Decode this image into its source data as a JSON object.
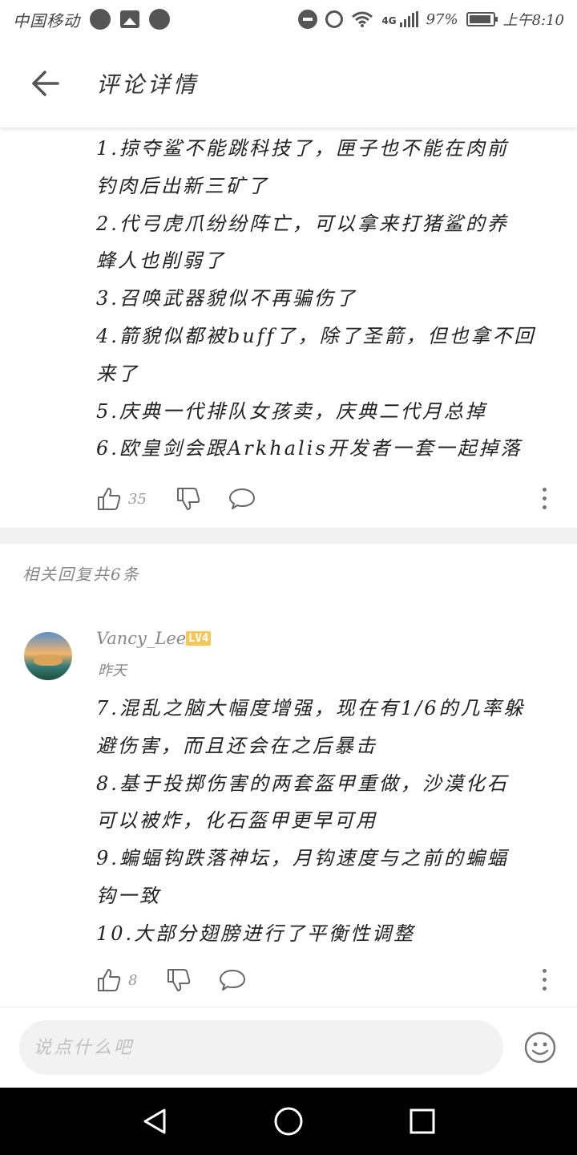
{
  "status_bar": {
    "carrier": "中国移动",
    "network": "4G",
    "battery": "97%",
    "time": "上午8:10"
  },
  "header": {
    "title": "评论详情"
  },
  "main_comment": {
    "lines": [
      "1.掠夺鲨不能跳科技了，匣子也不能在肉前",
      "钓肉后出新三矿了",
      "2.代弓虎爪纷纷阵亡，可以拿来打猪鲨的养",
      "蜂人也削弱了",
      "3.召唤武器貌似不再骗伤了",
      "4.箭貌似都被buff了，除了圣箭，但也拿不回",
      "来了",
      "5.庆典一代排队女孩卖，庆典二代月总掉",
      "6.欧皇剑会跟Arkhalis开发者一套一起掉落"
    ],
    "like_count": "35"
  },
  "related": {
    "header": "相关回复共6条"
  },
  "reply": {
    "username": "Vancy_Lee",
    "level": "LV4",
    "time": "昨天",
    "lines": [
      "7.混乱之脑大幅度增强，现在有1/6的几率躲",
      "避伤害，而且还会在之后暴击",
      "8.基于投掷伤害的两套盔甲重做，沙漠化石",
      "可以被炸，化石盔甲更早可用",
      "9.蝙蝠钩跌落神坛，月钩速度与之前的蝙蝠",
      "钩一致",
      "10.大部分翅膀进行了平衡性调整"
    ],
    "like_count": "8"
  },
  "input": {
    "placeholder": "说点什么吧"
  },
  "colors": {
    "level_badge": "#f5c65a",
    "navbar": "#000000",
    "divider_band": "#f1f1f1"
  },
  "icons": {
    "back": "arrow-left-icon",
    "like": "thumb-up-icon",
    "dislike": "thumb-down-icon",
    "reply": "speech-bubble-icon",
    "more": "more-vertical-icon",
    "emoji": "smiley-icon",
    "nav_back": "triangle-back-icon",
    "nav_home": "circle-home-icon",
    "nav_recent": "square-recent-icon"
  }
}
